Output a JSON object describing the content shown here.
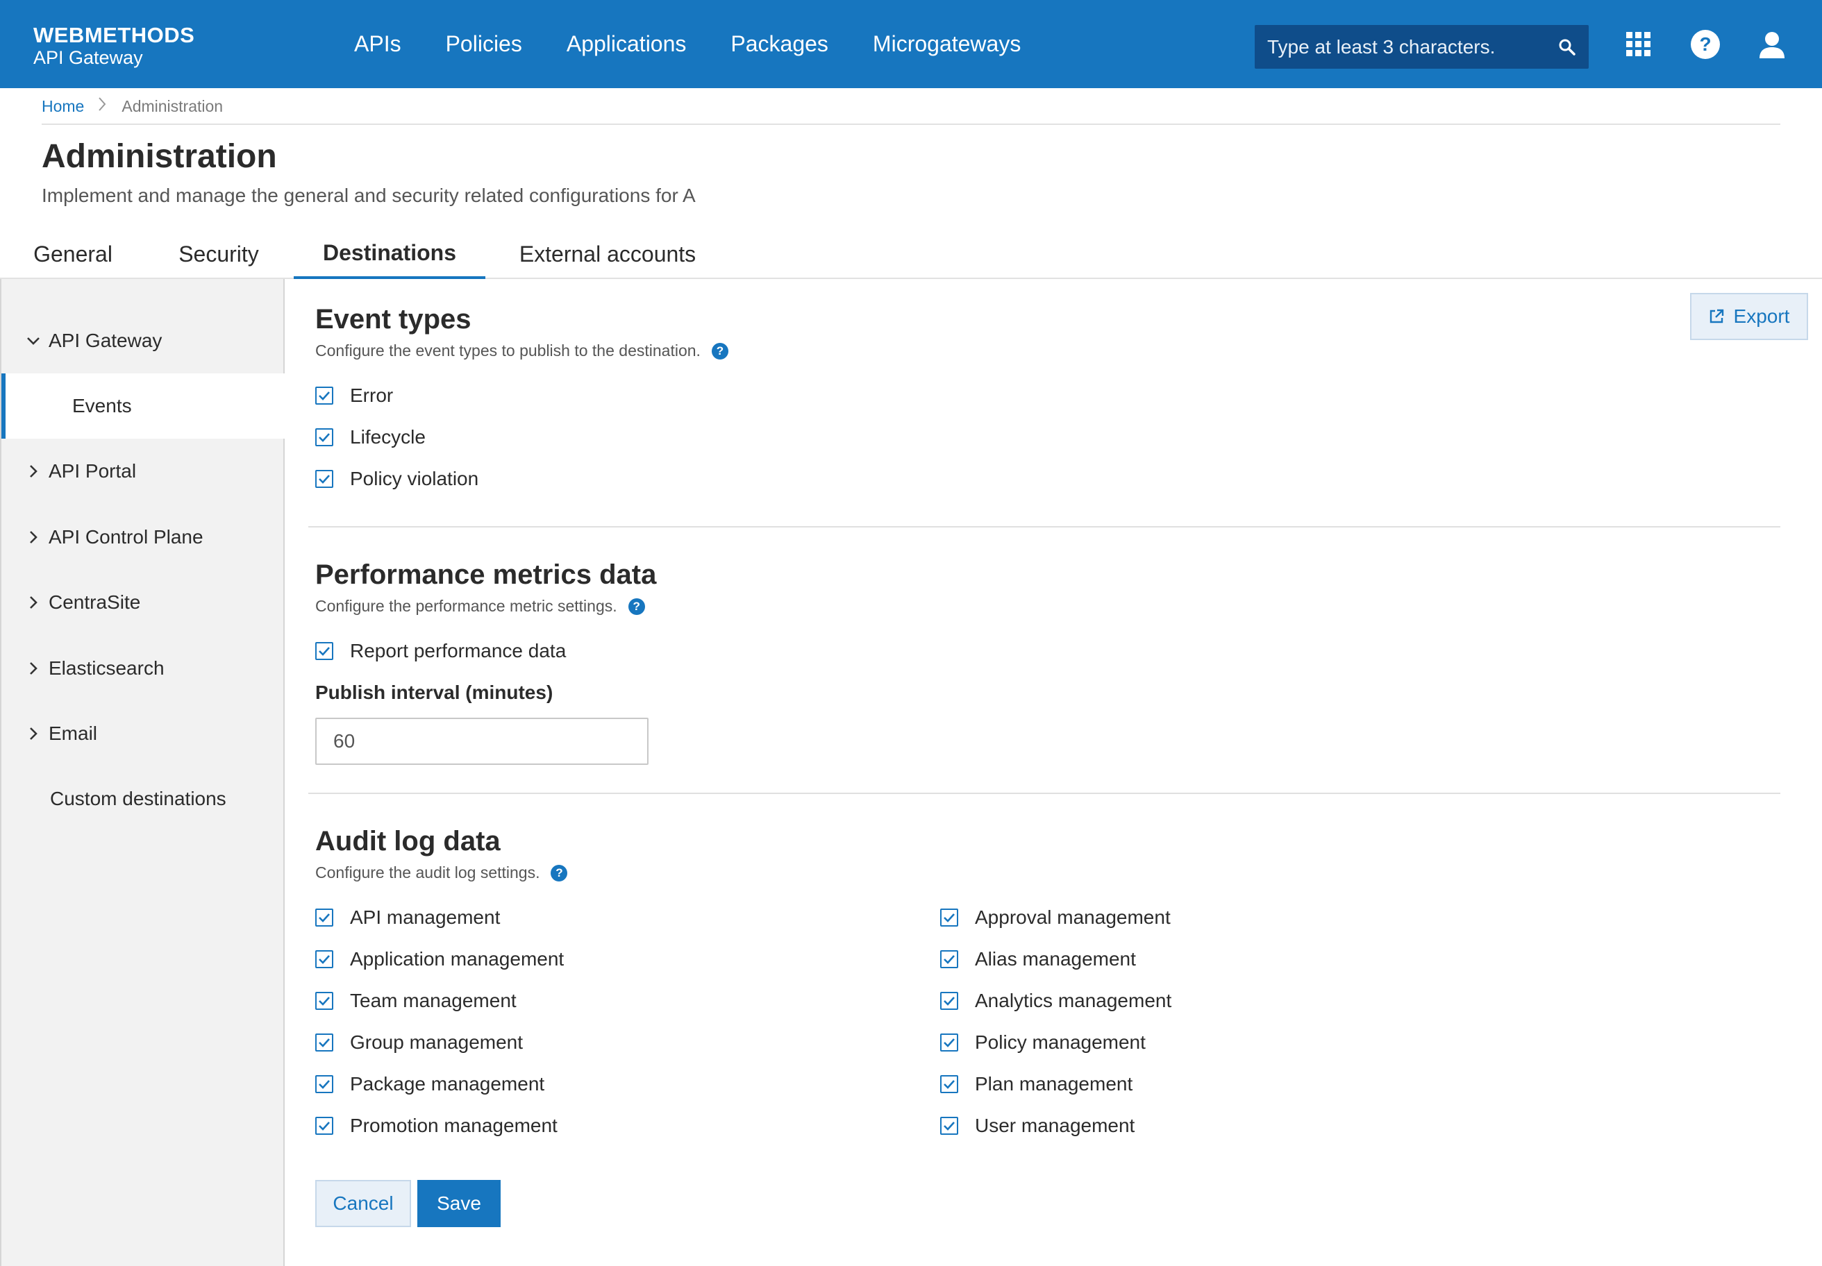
{
  "header": {
    "brand_title": "WEBMETHODS",
    "brand_subtitle": "API Gateway",
    "nav": [
      "APIs",
      "Policies",
      "Applications",
      "Packages",
      "Microgateways"
    ],
    "search_placeholder": "Type at least 3 characters.",
    "icons": [
      "search-icon",
      "app-grid-icon",
      "help-icon",
      "user-icon"
    ],
    "accent_color": "#1776bf"
  },
  "breadcrumb": {
    "home": "Home",
    "current": "Administration"
  },
  "page": {
    "title": "Administration",
    "description": "Implement and manage the general and security related configurations for A"
  },
  "tabs": [
    "General",
    "Security",
    "Destinations",
    "External accounts"
  ],
  "active_tab": "Destinations",
  "sidebar": {
    "items": [
      "API Gateway",
      "Events",
      "API Portal",
      "API Control Plane",
      "CentraSite",
      "Elasticsearch",
      "Email",
      "Custom destinations"
    ],
    "selected": "Events"
  },
  "export_label": "Export",
  "event_types": {
    "title": "Event types",
    "description": "Configure the event types to publish to the destination.",
    "options": [
      "Error",
      "Lifecycle",
      "Policy violation"
    ],
    "checked": [
      true,
      true,
      true
    ]
  },
  "performance": {
    "title": "Performance metrics data",
    "description": "Configure the performance metric settings.",
    "report_label": "Report performance data",
    "report_checked": true,
    "interval_label": "Publish interval (minutes)",
    "interval_value": "60"
  },
  "audit": {
    "title": "Audit log data",
    "description": "Configure the audit log settings.",
    "left": [
      "API management",
      "Application management",
      "Team management",
      "Group management",
      "Package management",
      "Promotion management"
    ],
    "right": [
      "Approval management",
      "Alias management",
      "Analytics management",
      "Policy management",
      "Plan management",
      "User management"
    ],
    "all_checked": true
  },
  "actions": {
    "cancel": "Cancel",
    "save": "Save"
  }
}
